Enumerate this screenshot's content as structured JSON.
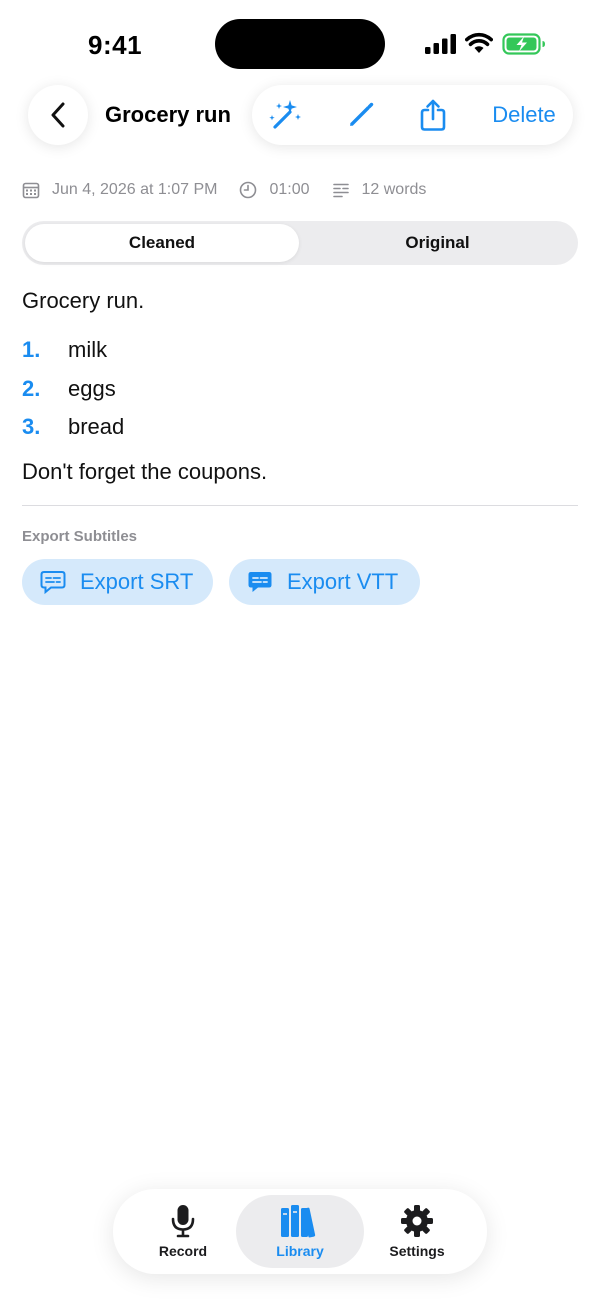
{
  "status_bar": {
    "time": "9:41"
  },
  "nav": {
    "title": "Grocery run",
    "delete_label": "Delete"
  },
  "meta": {
    "date": "Jun 4, 2026 at 1:07 PM",
    "duration": "01:00",
    "words": "12 words"
  },
  "segmented": {
    "options": [
      "Cleaned",
      "Original"
    ],
    "selected": "Cleaned"
  },
  "transcript": {
    "heading": "Grocery run.",
    "items": [
      {
        "num": "1.",
        "text": "milk"
      },
      {
        "num": "2.",
        "text": "eggs"
      },
      {
        "num": "3.",
        "text": "bread"
      }
    ],
    "footer": "Don't forget the coupons."
  },
  "export": {
    "label": "Export Subtitles",
    "srt_label": "Export SRT",
    "vtt_label": "Export VTT"
  },
  "tabs": [
    {
      "label": "Record",
      "icon": "microphone-icon"
    },
    {
      "label": "Library",
      "icon": "library-books-icon",
      "selected": true
    },
    {
      "label": "Settings",
      "icon": "gear-icon"
    }
  ],
  "colors": {
    "accent": "#1a8cf0",
    "secondary_text": "#8e8e93",
    "pill_background": "#d5e9fb",
    "battery": "#34c759"
  }
}
